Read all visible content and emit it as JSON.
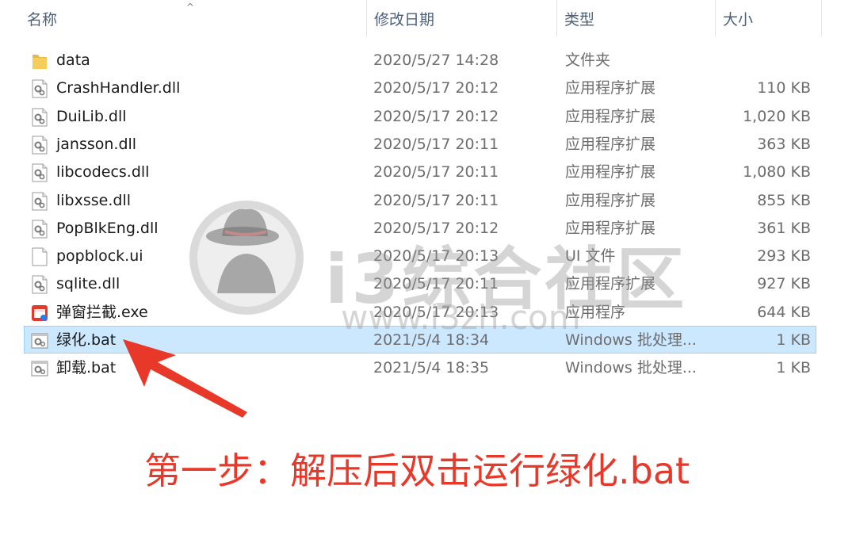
{
  "columns": {
    "name": "名称",
    "date": "修改日期",
    "type": "类型",
    "size": "大小"
  },
  "files": [
    {
      "name": "data",
      "date": "2020/5/27 14:28",
      "type": "文件夹",
      "size": "",
      "icon": "folder-icon",
      "selected": false
    },
    {
      "name": "CrashHandler.dll",
      "date": "2020/5/17 20:12",
      "type": "应用程序扩展",
      "size": "110 KB",
      "icon": "dll-file-icon",
      "selected": false
    },
    {
      "name": "DuiLib.dll",
      "date": "2020/5/17 20:12",
      "type": "应用程序扩展",
      "size": "1,020 KB",
      "icon": "dll-file-icon",
      "selected": false
    },
    {
      "name": "jansson.dll",
      "date": "2020/5/17 20:11",
      "type": "应用程序扩展",
      "size": "363 KB",
      "icon": "dll-file-icon",
      "selected": false
    },
    {
      "name": "libcodecs.dll",
      "date": "2020/5/17 20:11",
      "type": "应用程序扩展",
      "size": "1,080 KB",
      "icon": "dll-file-icon",
      "selected": false
    },
    {
      "name": "libxsse.dll",
      "date": "2020/5/17 20:11",
      "type": "应用程序扩展",
      "size": "855 KB",
      "icon": "dll-file-icon",
      "selected": false
    },
    {
      "name": "PopBlkEng.dll",
      "date": "2020/5/17 20:12",
      "type": "应用程序扩展",
      "size": "361 KB",
      "icon": "dll-file-icon",
      "selected": false
    },
    {
      "name": "popblock.ui",
      "date": "2020/5/17 20:13",
      "type": "UI 文件",
      "size": "293 KB",
      "icon": "blank-file-icon",
      "selected": false
    },
    {
      "name": "sqlite.dll",
      "date": "2020/5/17 20:11",
      "type": "应用程序扩展",
      "size": "927 KB",
      "icon": "dll-file-icon",
      "selected": false
    },
    {
      "name": "弹窗拦截.exe",
      "date": "2020/5/17 20:13",
      "type": "应用程序",
      "size": "644 KB",
      "icon": "app-exe-icon",
      "selected": false
    },
    {
      "name": "绿化.bat",
      "date": "2021/5/4 18:34",
      "type": "Windows 批处理...",
      "size": "1 KB",
      "icon": "batch-file-icon",
      "selected": true
    },
    {
      "name": "卸载.bat",
      "date": "2021/5/4 18:35",
      "type": "Windows 批处理...",
      "size": "1 KB",
      "icon": "batch-file-icon",
      "selected": false
    }
  ],
  "watermark": {
    "text": "i3综合社区",
    "url": "www.i3zh.com"
  },
  "annotation": {
    "text": "第一步：解压后双击运行绿化.bat",
    "color": "#e8382a"
  },
  "colors": {
    "selection": "#cce8ff",
    "selection_border": "#99d1ff",
    "header_text": "#4c607a",
    "folder": "#e8b94a"
  }
}
